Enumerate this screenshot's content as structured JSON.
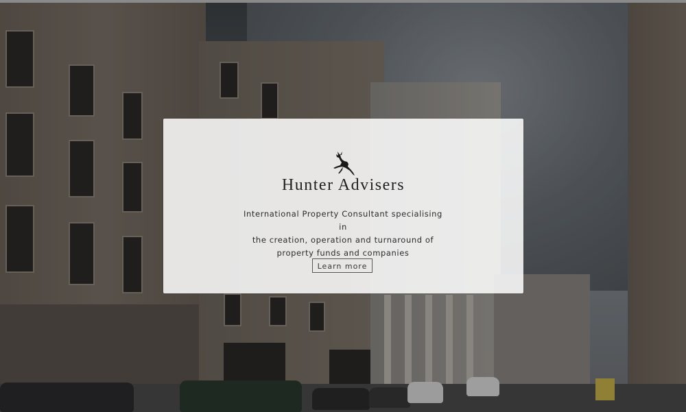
{
  "brand": {
    "logo_icon": "leaping-stag-icon",
    "name": "Hunter Advisers"
  },
  "hero": {
    "tagline_lines": [
      "International Property Consultant specialising in",
      "the creation, operation and turnaround of",
      "property funds and companies"
    ],
    "cta_label": "Learn more"
  },
  "colors": {
    "card_background": "#ffffff",
    "text": "#1f1f1f",
    "button_border": "#555555"
  }
}
